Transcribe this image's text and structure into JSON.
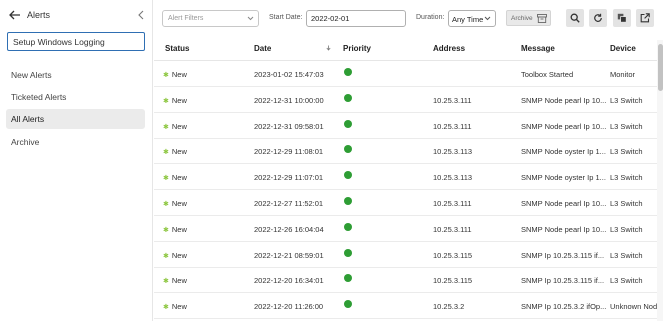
{
  "sidebar": {
    "title": "Alerts",
    "search_value": "Setup Windows Logging",
    "items": [
      {
        "label": "New Alerts"
      },
      {
        "label": "Ticketed Alerts"
      },
      {
        "label": "All Alerts",
        "active": true
      },
      {
        "label": "Archive"
      }
    ]
  },
  "toolbar": {
    "filter_placeholder": "Alert Filters",
    "start_date_label": "Start Date:",
    "start_date_value": "2022-02-01",
    "duration_label": "Duration:",
    "duration_value": "Any Time",
    "archive_label": "Archive",
    "icons": [
      "search-icon",
      "refresh-icon",
      "copy-icon",
      "export-icon"
    ]
  },
  "table": {
    "columns": [
      "Status",
      "Date",
      "Priority",
      "Address",
      "Message",
      "Device"
    ],
    "rows": [
      {
        "status": "New",
        "date": "2023-01-02 15:47:03",
        "address": "",
        "message": "Toolbox Started",
        "device": "Monitor"
      },
      {
        "status": "New",
        "date": "2022-12-31 10:00:00",
        "address": "10.25.3.111",
        "message": "SNMP Node pearl Ip 10...",
        "device": "L3 Switch"
      },
      {
        "status": "New",
        "date": "2022-12-31 09:58:01",
        "address": "10.25.3.111",
        "message": "SNMP Node pearl Ip 10...",
        "device": "L3 Switch"
      },
      {
        "status": "New",
        "date": "2022-12-29 11:08:01",
        "address": "10.25.3.113",
        "message": "SNMP Node oyster Ip 1...",
        "device": "L3 Switch"
      },
      {
        "status": "New",
        "date": "2022-12-29 11:07:01",
        "address": "10.25.3.113",
        "message": "SNMP Node oyster Ip 1...",
        "device": "L3 Switch"
      },
      {
        "status": "New",
        "date": "2022-12-27 11:52:01",
        "address": "10.25.3.111",
        "message": "SNMP Node pearl Ip 10...",
        "device": "L3 Switch"
      },
      {
        "status": "New",
        "date": "2022-12-26 16:04:04",
        "address": "10.25.3.111",
        "message": "SNMP Node pearl Ip 10...",
        "device": "L3 Switch"
      },
      {
        "status": "New",
        "date": "2022-12-21 08:59:01",
        "address": "10.25.3.115",
        "message": "SNMP Ip 10.25.3.115 if...",
        "device": "L3 Switch"
      },
      {
        "status": "New",
        "date": "2022-12-20 16:34:01",
        "address": "10.25.3.115",
        "message": "SNMP Ip 10.25.3.115 if...",
        "device": "L3 Switch"
      },
      {
        "status": "New",
        "date": "2022-12-20 11:26:00",
        "address": "10.25.3.2",
        "message": "SNMP Ip 10.25.3.2 ifOp...",
        "device": "Unknown Node"
      }
    ]
  },
  "colors": {
    "accent": "#2f6fb3",
    "priority_ok": "#2e9d34",
    "status_new": "#8cc63f"
  }
}
